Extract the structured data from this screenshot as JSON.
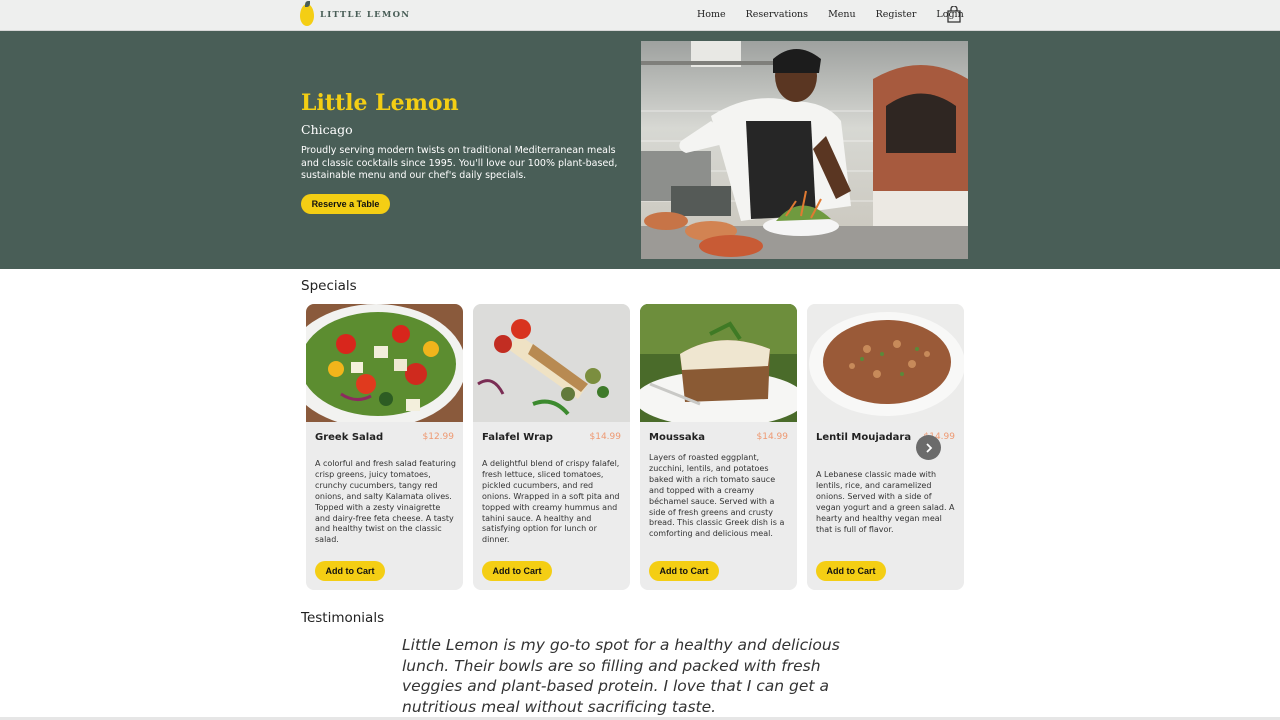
{
  "nav": {
    "logo_text": "LITTLE LEMON",
    "links": [
      "Home",
      "Reservations",
      "Menu",
      "Register",
      "Login"
    ],
    "cart_icon": "shopping-bag-icon"
  },
  "hero": {
    "title": "Little Lemon",
    "subtitle": "Chicago",
    "description": "Proudly serving modern twists on traditional Mediterranean meals and classic cocktails since 1995. You'll love our 100% plant-based, sustainable menu and our chef's daily specials.",
    "button_label": "Reserve a Table",
    "image": "chef-plating-photo"
  },
  "specials": {
    "title": "Specials",
    "items": [
      {
        "name": "Greek Salad",
        "price": "$12.99",
        "description": "A colorful and fresh salad featuring crisp greens, juicy tomatoes, crunchy cucumbers, tangy red onions, and salty Kalamata olives. Topped with a zesty vinaigrette and dairy-free feta cheese. A tasty and healthy twist on the classic salad.",
        "button_label": "Add to Cart"
      },
      {
        "name": "Falafel Wrap",
        "price": "$14.99",
        "description": "A delightful blend of crispy falafel, fresh lettuce, sliced tomatoes, pickled cucumbers, and red onions. Wrapped in a soft pita and topped with creamy hummus and tahini sauce. A healthy and satisfying option for lunch or dinner.",
        "button_label": "Add to Cart"
      },
      {
        "name": "Moussaka",
        "price": "$14.99",
        "description": "Layers of roasted eggplant, zucchini, lentils, and potatoes baked with a rich tomato sauce and topped with a creamy béchamel sauce. Served with a side of fresh greens and crusty bread. This classic Greek dish is a comforting and delicious meal.",
        "button_label": "Add to Cart"
      },
      {
        "name": "Lentil Moujadara",
        "price": "$14.99",
        "description": "A Lebanese classic made with lentils, rice, and caramelized onions. Served with a side of vegan yogurt and a green salad. A hearty and healthy vegan meal that is full of flavor.",
        "button_label": "Add to Cart"
      }
    ],
    "next_icon": "chevron-right-icon"
  },
  "testimonials": {
    "title": "Testimonials",
    "quote": "Little Lemon is my go-to spot for a healthy and delicious lunch. Their bowls are so filling and packed with fresh veggies and plant-based protein. I love that I can get a nutritious meal without sacrificing taste."
  },
  "colors": {
    "primary_green": "#495e57",
    "primary_yellow": "#f4ce14",
    "price_orange": "#ee9972",
    "card_bg": "#ececec",
    "nav_bg": "#eeefee"
  }
}
